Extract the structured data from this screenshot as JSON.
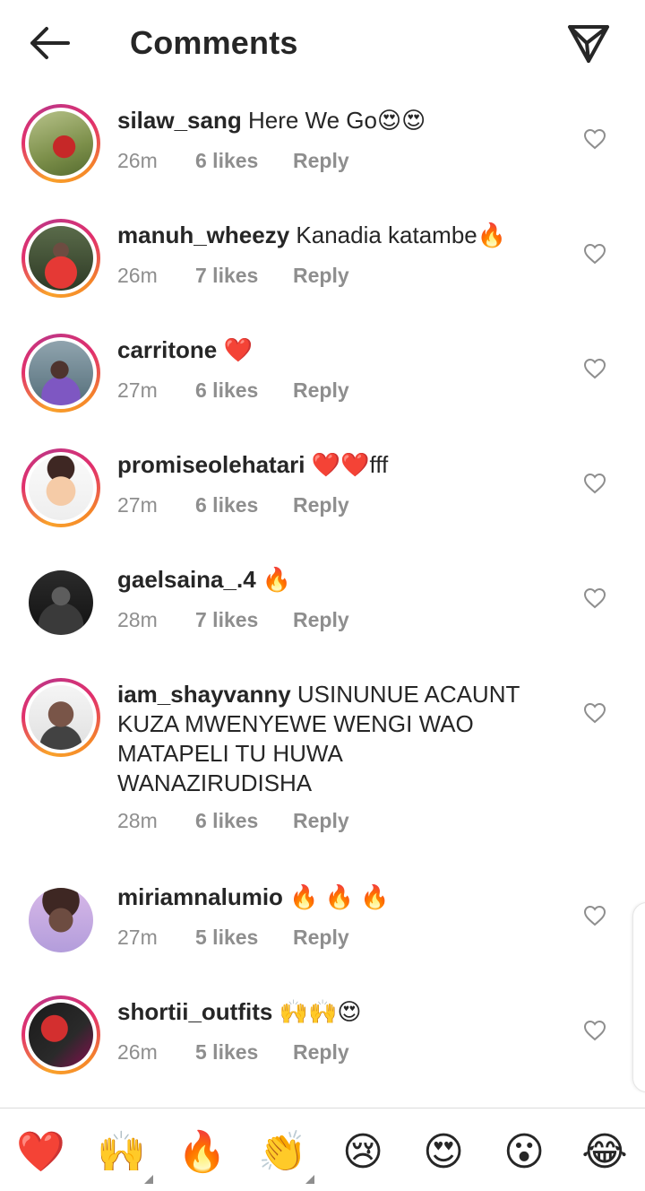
{
  "header": {
    "title": "Comments",
    "back_icon": "arrow-left-icon",
    "share_icon": "send-icon"
  },
  "comments": [
    {
      "username": "silaw_sang",
      "text": " Here We Go😍😍",
      "time": "26m",
      "likes": "6 likes",
      "reply": "Reply",
      "story_ring": true
    },
    {
      "username": "manuh_wheezy",
      "text": " Kanadia katambe🔥",
      "time": "26m",
      "likes": "7 likes",
      "reply": "Reply",
      "story_ring": true
    },
    {
      "username": "carritone",
      "text": " ❤️",
      "time": "27m",
      "likes": "6 likes",
      "reply": "Reply",
      "story_ring": true
    },
    {
      "username": "promiseolehatari",
      "text": " ❤️❤️fff",
      "time": "27m",
      "likes": "6 likes",
      "reply": "Reply",
      "story_ring": true
    },
    {
      "username": "gaelsaina_.4",
      "text": " 🔥",
      "time": "28m",
      "likes": "7 likes",
      "reply": "Reply",
      "story_ring": false
    },
    {
      "username": "iam_shayvanny",
      "text": " USINUNUE ACAUNT KUZA MWENYEWE WENGI WAO MATAPELI TU  HUWA WANAZIRUDISHA",
      "time": "28m",
      "likes": "6 likes",
      "reply": "Reply",
      "story_ring": true
    },
    {
      "username": "miriamnalumio",
      "text": " 🔥 🔥 🔥",
      "time": "27m",
      "likes": "5 likes",
      "reply": "Reply",
      "story_ring": false
    },
    {
      "username": "shortii_outfits",
      "text": " 🙌🙌😍",
      "time": "26m",
      "likes": "5 likes",
      "reply": "Reply",
      "story_ring": true
    }
  ],
  "emoji_bar": [
    "❤️",
    "🙌",
    "🔥",
    "👏",
    "😢",
    "😍",
    "😮",
    "😂"
  ],
  "colors": {
    "text": "#262626",
    "secondary": "#8e8e8e",
    "ring_start": "#f9a22b",
    "ring_end": "#c13584"
  }
}
